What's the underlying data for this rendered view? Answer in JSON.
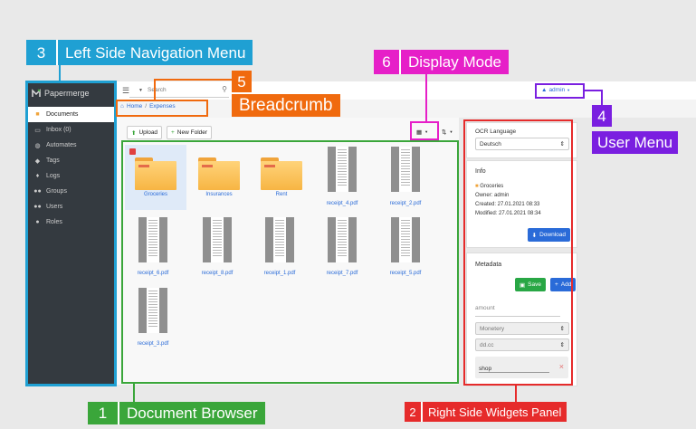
{
  "app": {
    "name": "Papermerge",
    "search_placeholder": "Search",
    "user_menu": "admin",
    "breadcrumb": [
      "Home",
      "/",
      "Expenses"
    ],
    "toolbar": {
      "upload": "Upload",
      "new_folder": "New Folder"
    }
  },
  "sidebar": {
    "items": [
      {
        "label": "Documents",
        "icon": "folder-icon",
        "active": true
      },
      {
        "label": "Inbox (0)",
        "icon": "inbox-icon"
      },
      {
        "label": "Automates",
        "icon": "robot-icon"
      },
      {
        "label": "Tags",
        "icon": "tag-icon"
      },
      {
        "label": "Logs",
        "icon": "lightbulb-icon"
      },
      {
        "label": "Groups",
        "icon": "group-icon"
      },
      {
        "label": "Users",
        "icon": "users-icon"
      },
      {
        "label": "Roles",
        "icon": "user-icon"
      }
    ]
  },
  "browser": {
    "folders": [
      "Groceries",
      "Insurances",
      "Rent"
    ],
    "documents": [
      "receipt_4.pdf",
      "receipt_2.pdf",
      "receipt_6.pdf",
      "receipt_8.pdf",
      "receipt_1.pdf",
      "receipt_7.pdf",
      "receipt_5.pdf",
      "receipt_3.pdf"
    ]
  },
  "widgets": {
    "ocr": {
      "label": "OCR Language",
      "value": "Deutsch"
    },
    "info": {
      "title": "Info",
      "folder": "Groceries",
      "owner": "Owner:  admin",
      "created": "Created:  27.01.2021 08:33",
      "modified": "Modified:  27.01.2021 08:34",
      "download": "Download"
    },
    "metadata": {
      "title": "Metadata",
      "save": "Save",
      "add": "Add",
      "key_placeholder": "amount",
      "kv_type": "Monetery",
      "format": "dd.cc",
      "shop_value": "shop"
    }
  },
  "annotations": [
    {
      "num": "1",
      "label": "Document Browser",
      "color": "#3aa63a"
    },
    {
      "num": "2",
      "label": "Right Side Widgets Panel",
      "color": "#e62b2b"
    },
    {
      "num": "3",
      "label": "Left Side Navigation Menu",
      "color": "#1fa0d3"
    },
    {
      "num": "4",
      "label": "User Menu",
      "color": "#7a1fe0"
    },
    {
      "num": "5",
      "label": "Breadcrumb",
      "color": "#f06a0e"
    },
    {
      "num": "6",
      "label": "Display Mode",
      "color": "#e61fc8"
    }
  ]
}
